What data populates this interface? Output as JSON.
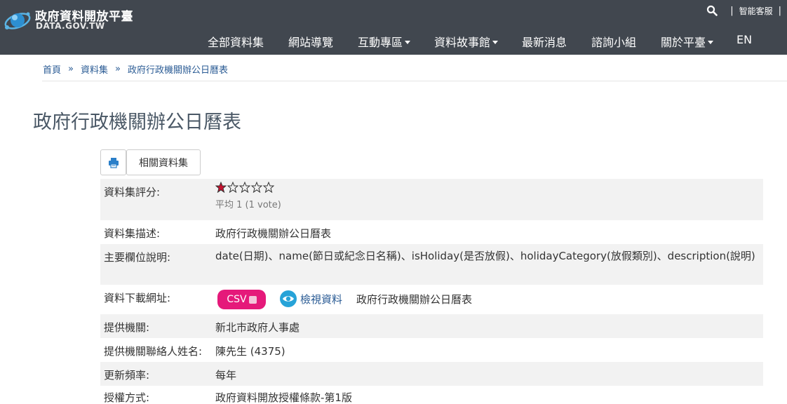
{
  "header": {
    "brand_title": "政府資料開放平臺",
    "brand_subtitle": "DATA.GOV.TW",
    "utility": {
      "separator": "|",
      "service_label": "智能客服"
    },
    "nav": [
      {
        "label": "全部資料集",
        "dropdown": false
      },
      {
        "label": "網站導覽",
        "dropdown": false
      },
      {
        "label": "互動專區",
        "dropdown": true
      },
      {
        "label": "資料故事館",
        "dropdown": true
      },
      {
        "label": "最新消息",
        "dropdown": false
      },
      {
        "label": "諮詢小組",
        "dropdown": false
      },
      {
        "label": "關於平臺",
        "dropdown": true
      },
      {
        "label": "EN",
        "dropdown": false
      }
    ]
  },
  "breadcrumb": {
    "items": [
      "首頁",
      "資料集",
      "政府行政機關辦公日曆表"
    ],
    "separator": "»"
  },
  "page_title": "政府行政機關辦公日曆表",
  "buttons": {
    "related": "相關資料集"
  },
  "dataset": {
    "rating": {
      "label": "資料集評分:",
      "filled_stars": 1,
      "total_stars": 5,
      "average_text": "平均 1 (1 vote)"
    },
    "description": {
      "label": "資料集描述:",
      "value": "政府行政機關辦公日曆表"
    },
    "fields": {
      "label": "主要欄位說明:",
      "value": "date(日期)、name(節日或紀念日名稱)、isHoliday(是否放假)、holidayCategory(放假類別)、description(說明)"
    },
    "download": {
      "label": "資料下載網址:",
      "format": "CSV",
      "view_label": "檢視資料",
      "resource_name": "政府行政機關辦公日曆表"
    },
    "provider": {
      "label": "提供機關:",
      "value": "新北市政府人事處"
    },
    "contact": {
      "label": "提供機關聯絡人姓名:",
      "value": "陳先生 (4375)"
    },
    "frequency": {
      "label": "更新頻率:",
      "value": "每年"
    },
    "license": {
      "label": "授權方式:",
      "value": "政府資料開放授權條款-第1版"
    }
  },
  "colors": {
    "header_bg": "#41474f",
    "link": "#2a5b94",
    "csv_button": "#e5197a",
    "row_shade": "#f2f2f2",
    "star_filled": "#c8102e"
  }
}
